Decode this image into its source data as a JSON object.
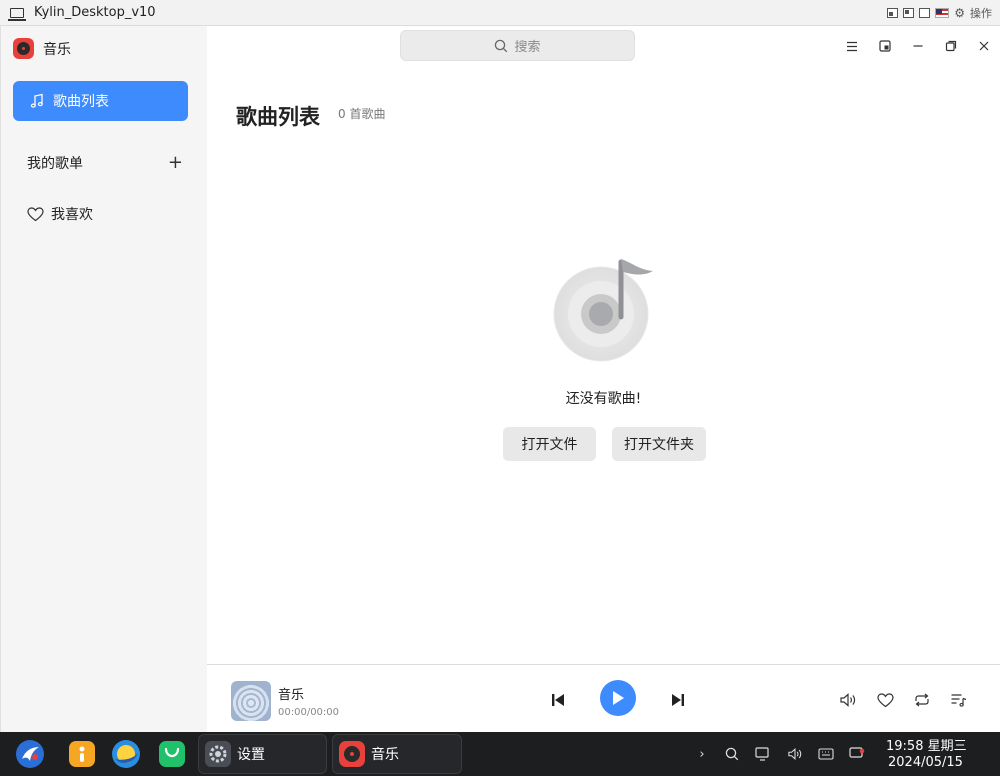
{
  "vm": {
    "title": "Kylin_Desktop_v10",
    "actions_label": "操作"
  },
  "app": {
    "name": "音乐"
  },
  "sidebar": {
    "nav_active": "歌曲列表",
    "my_playlists": "我的歌单",
    "favorites": "我喜欢"
  },
  "header": {
    "search_placeholder": "搜索"
  },
  "main": {
    "title": "歌曲列表",
    "count": "0 首歌曲",
    "empty_text": "还没有歌曲!",
    "open_file": "打开文件",
    "open_folder": "打开文件夹"
  },
  "player": {
    "track_name": "音乐",
    "time": "00:00/00:00"
  },
  "taskbar": {
    "settings_label": "设置",
    "music_label": "音乐",
    "time": "19:58 星期三",
    "date": "2024/05/15"
  },
  "colors": {
    "accent": "#3d8bfd",
    "sidebar_bg": "#f5f5f5",
    "taskbar_bg": "#1d1e20"
  }
}
